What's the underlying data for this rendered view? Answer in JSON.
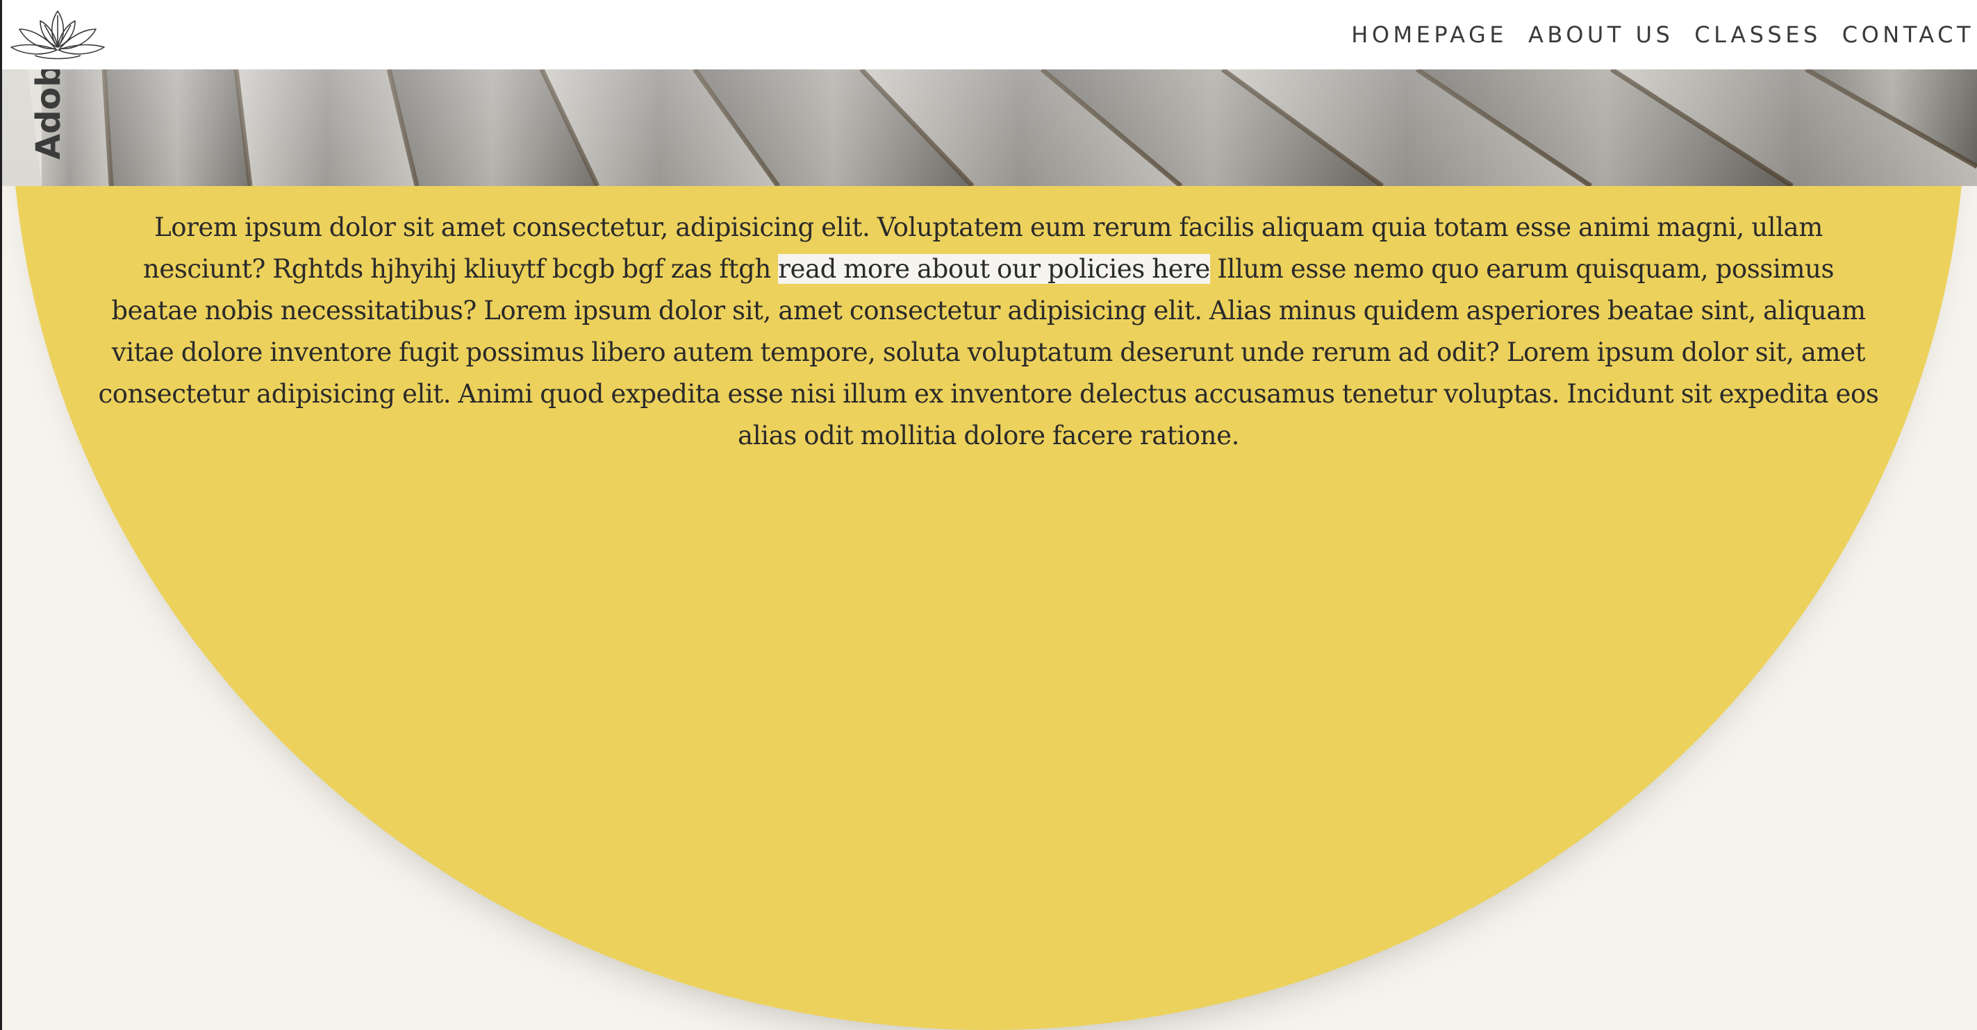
{
  "header": {
    "logo_icon": "lotus-flower-logo",
    "nav": [
      {
        "label": "HOMEPAGE"
      },
      {
        "label": "ABOUT US"
      },
      {
        "label": "CLASSES"
      },
      {
        "label": "CONTACT"
      }
    ]
  },
  "banner": {
    "image": "wooden-planks-photo",
    "watermark": "Adob"
  },
  "content": {
    "text_before_link": "Lorem ipsum dolor sit amet consectetur, adipisicing elit. Voluptatem eum rerum facilis aliquam quia totam esse animi magni, ullam nesciunt? Rghtds hjhyihj kliuytf bcgb bgf zas ftgh ",
    "link_text": "read more about our policies here",
    "text_after_link": " Illum esse nemo quo earum quisquam, possimus beatae nobis necessitatibus? Lorem ipsum dolor sit, amet consectetur adipisicing elit. Alias minus quidem asperiores beatae sint, aliquam vitae dolore inventore fugit possimus libero autem tempore, soluta voluptatum deserunt unde rerum ad odit? Lorem ipsum dolor sit, amet consectetur adipisicing elit. Animi quod expedita esse nisi illum ex inventore delectus accusamus tenetur voluptas. Incidunt sit expedita eos alias odit mollitia dolore facere ratione."
  },
  "colors": {
    "accent_yellow": "#ecd15c",
    "background": "#f6f3ec",
    "header_bg": "#ffffff",
    "text": "#2a2a2a"
  }
}
